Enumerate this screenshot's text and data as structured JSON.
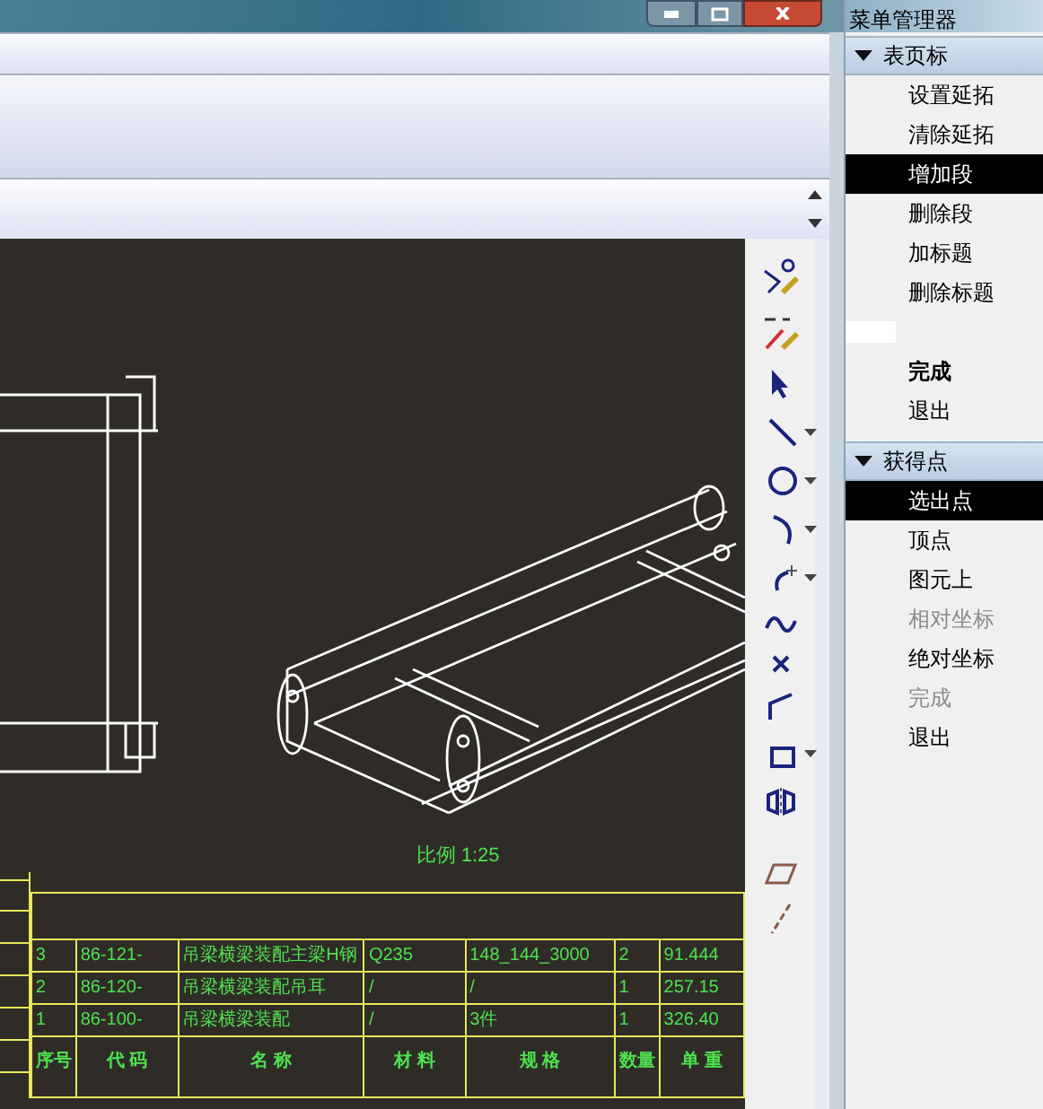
{
  "drawing": {
    "scale_label": "比例 1:25",
    "bom_table": {
      "rows": [
        {
          "kind": "item",
          "cells": [
            "3",
            "86-121-",
            "吊梁横梁装配主梁H钢",
            "Q235",
            "148_144_3000",
            "2",
            "91.444"
          ]
        },
        {
          "kind": "item",
          "cells": [
            "2",
            "86-120-",
            "吊梁横梁装配吊耳",
            "/",
            "/",
            "1",
            "257.15"
          ]
        },
        {
          "kind": "item",
          "cells": [
            "1",
            "86-100-",
            "吊梁横梁装配",
            "/",
            "3件",
            "1",
            "326.40"
          ]
        },
        {
          "kind": "header",
          "cells": [
            "序号",
            "代 码",
            "名 称",
            "材 料",
            "规 格",
            "数量",
            "单 重"
          ]
        }
      ]
    }
  },
  "menu_manager": {
    "title": "菜单管理器",
    "sections": [
      {
        "title": "表页标",
        "expanded": true,
        "items": [
          {
            "kind": "normal",
            "label": "设置延拓",
            "selected": false,
            "disabled": false
          },
          {
            "kind": "normal",
            "label": "清除延拓",
            "selected": false,
            "disabled": false
          },
          {
            "kind": "normal",
            "label": "增加段",
            "selected": true,
            "disabled": false
          },
          {
            "kind": "normal",
            "label": "删除段",
            "selected": false,
            "disabled": false
          },
          {
            "kind": "normal",
            "label": "加标题",
            "selected": false,
            "disabled": false
          },
          {
            "kind": "normal",
            "label": "删除标题",
            "selected": false,
            "disabled": false
          },
          {
            "kind": "blank",
            "selected": false
          },
          {
            "kind": "bold",
            "label": "完成",
            "selected": false,
            "disabled": false
          },
          {
            "kind": "normal",
            "label": "退出",
            "selected": false,
            "disabled": false
          }
        ]
      },
      {
        "title": "获得点",
        "expanded": true,
        "items": [
          {
            "kind": "normal",
            "label": "选出点",
            "selected": true,
            "disabled": false
          },
          {
            "kind": "normal",
            "label": "顶点",
            "selected": false,
            "disabled": false
          },
          {
            "kind": "normal",
            "label": "图元上",
            "selected": false,
            "disabled": false
          },
          {
            "kind": "normal",
            "label": "相对坐标",
            "selected": false,
            "disabled": true
          },
          {
            "kind": "normal",
            "label": "绝对坐标",
            "selected": false,
            "disabled": false
          },
          {
            "kind": "normal",
            "label": "完成",
            "selected": false,
            "disabled": true
          },
          {
            "kind": "normal",
            "label": "退出",
            "selected": false,
            "disabled": false
          }
        ]
      }
    ]
  }
}
